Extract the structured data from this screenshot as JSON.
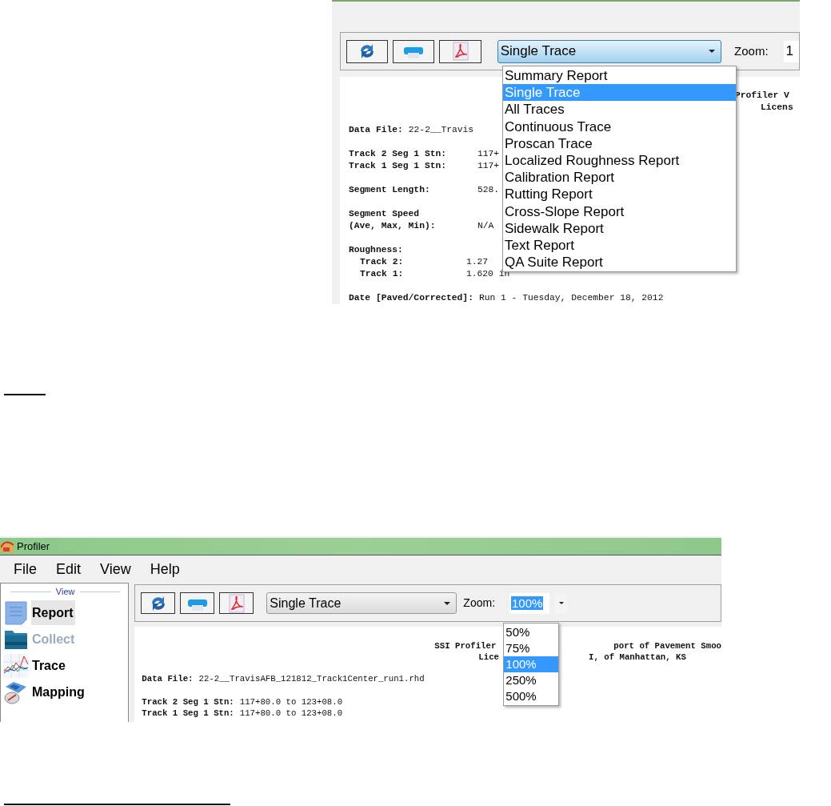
{
  "top_screenshot": {
    "toolbar": {
      "buttons": [
        {
          "kind": "refresh"
        },
        {
          "kind": "print"
        },
        {
          "kind": "pdf"
        }
      ],
      "report_select": "Single Trace",
      "zoom_label": "Zoom:",
      "zoom_value": "1"
    },
    "report_options": [
      {
        "label": "Summary Report",
        "selected": false
      },
      {
        "label": "Single Trace",
        "selected": true
      },
      {
        "label": "All Traces",
        "selected": false
      },
      {
        "label": "Continuous Trace",
        "selected": false
      },
      {
        "label": "Proscan Trace",
        "selected": false
      },
      {
        "label": "Localized Roughness Report",
        "selected": false
      },
      {
        "label": "Calibration Report",
        "selected": false
      },
      {
        "label": "Rutting Report",
        "selected": false
      },
      {
        "label": "Cross-Slope Report",
        "selected": false
      },
      {
        "label": "Sidewalk Report",
        "selected": false
      },
      {
        "label": "Text Report",
        "selected": false
      },
      {
        "label": "QA Suite Report",
        "selected": false
      }
    ],
    "report_header": [
      [
        "Profiler V"
      ],
      [
        "Licens"
      ]
    ],
    "report_body": [
      [
        {
          "label": "Data File:",
          "value": "22-2__Travis"
        }
      ],
      [
        {
          "label": "Track 2 Seg 1 Stn:",
          "value": "117+"
        },
        {
          "label": "Track 1 Seg 1 Stn:",
          "value": "117+"
        }
      ],
      [
        {
          "label": "Segment Length:",
          "value": "528."
        }
      ],
      [
        {
          "label": "Segment Speed"
        },
        {
          "label": "(Ave, Max, Min):",
          "value": "N/A"
        }
      ],
      [
        {
          "label": "Roughness:"
        },
        {
          "label": "Track 2:",
          "value": "1.27",
          "kind": "sub"
        },
        {
          "label": "Track 1:",
          "value": "1.620 in",
          "kind": "sub"
        }
      ],
      [
        {
          "label": "Date [Paved/Corrected]:",
          "value": "Run 1 - Tuesday, December 18, 2012"
        }
      ]
    ]
  },
  "bottom_screenshot": {
    "window": {
      "title": "Profiler"
    },
    "menu": [
      "File",
      "Edit",
      "View",
      "Help"
    ],
    "sidebar": {
      "header": "View",
      "items": [
        {
          "label": "Report",
          "kind": "report",
          "selected": true,
          "disabled": false
        },
        {
          "label": "Collect",
          "kind": "collect",
          "selected": false,
          "disabled": true
        },
        {
          "label": "Trace",
          "kind": "trace",
          "selected": false,
          "disabled": false
        },
        {
          "label": "Mapping",
          "kind": "mapping",
          "selected": false,
          "disabled": false
        }
      ]
    },
    "toolbar": {
      "buttons": [
        {
          "kind": "refresh"
        },
        {
          "kind": "print"
        },
        {
          "kind": "pdf"
        }
      ],
      "report_select": "Single Trace",
      "zoom_label": "Zoom:",
      "zoom_value": "100%"
    },
    "zoom_options": [
      {
        "label": "50%",
        "selected": false
      },
      {
        "label": "75%",
        "selected": false
      },
      {
        "label": "100%",
        "selected": true
      },
      {
        "label": "250%",
        "selected": false
      },
      {
        "label": "500%",
        "selected": false
      }
    ],
    "report_header": [
      [
        "SSI Profiler",
        "port of Pavement Smoo"
      ],
      [
        "Lice",
        "I, of Manhattan, KS"
      ]
    ],
    "report_body": [
      [
        {
          "label": "Data File:",
          "value": "22-2__TravisAFB_121812_Track1Center_run1.rhd"
        }
      ],
      [
        {
          "label": "Track 2 Seg 1 Stn:",
          "value": "117+80.0 to 123+08.0"
        },
        {
          "label": "Track 1 Seg 1 Stn:",
          "value": "117+80.0 to 123+08.0"
        }
      ]
    ]
  }
}
